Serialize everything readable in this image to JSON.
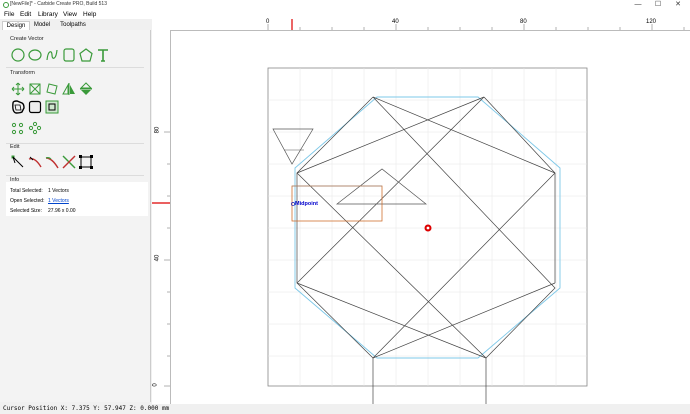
{
  "window": {
    "title": "[NewFile]* - Carbide Create PRO, Build 513",
    "minimize": "—",
    "maximize": "☐",
    "close": "✕"
  },
  "menu": [
    "File",
    "Edit",
    "Library",
    "View",
    "Help"
  ],
  "tabs": [
    "Design",
    "Model",
    "Toolpaths"
  ],
  "sections": {
    "create_vector": "Create Vector",
    "transform": "Transform",
    "edit": "Edit",
    "info": "Info"
  },
  "info": {
    "total_selected_label": "Total Selected:",
    "total_selected_value": "1 Vectors",
    "open_selected_label": "Open Selected:",
    "open_selected_value": "1 Vectors",
    "selected_size_label": "Selected Size:",
    "selected_size_value": "27.96 x 0.00"
  },
  "rulers": {
    "top": [
      "0",
      "40",
      "80",
      "120"
    ],
    "left": [
      "80",
      "40",
      "0"
    ]
  },
  "canvas": {
    "snap_label": "Midpoint"
  },
  "status": "Cursor Position X: 7.375 Y: 57.947 Z: 0.000 mm",
  "colors": {
    "accent_green": "#3a9a3a",
    "offset_blue": "#7ec8e8",
    "selection_orange": "#d07030",
    "cursor_red": "#dd0000"
  }
}
